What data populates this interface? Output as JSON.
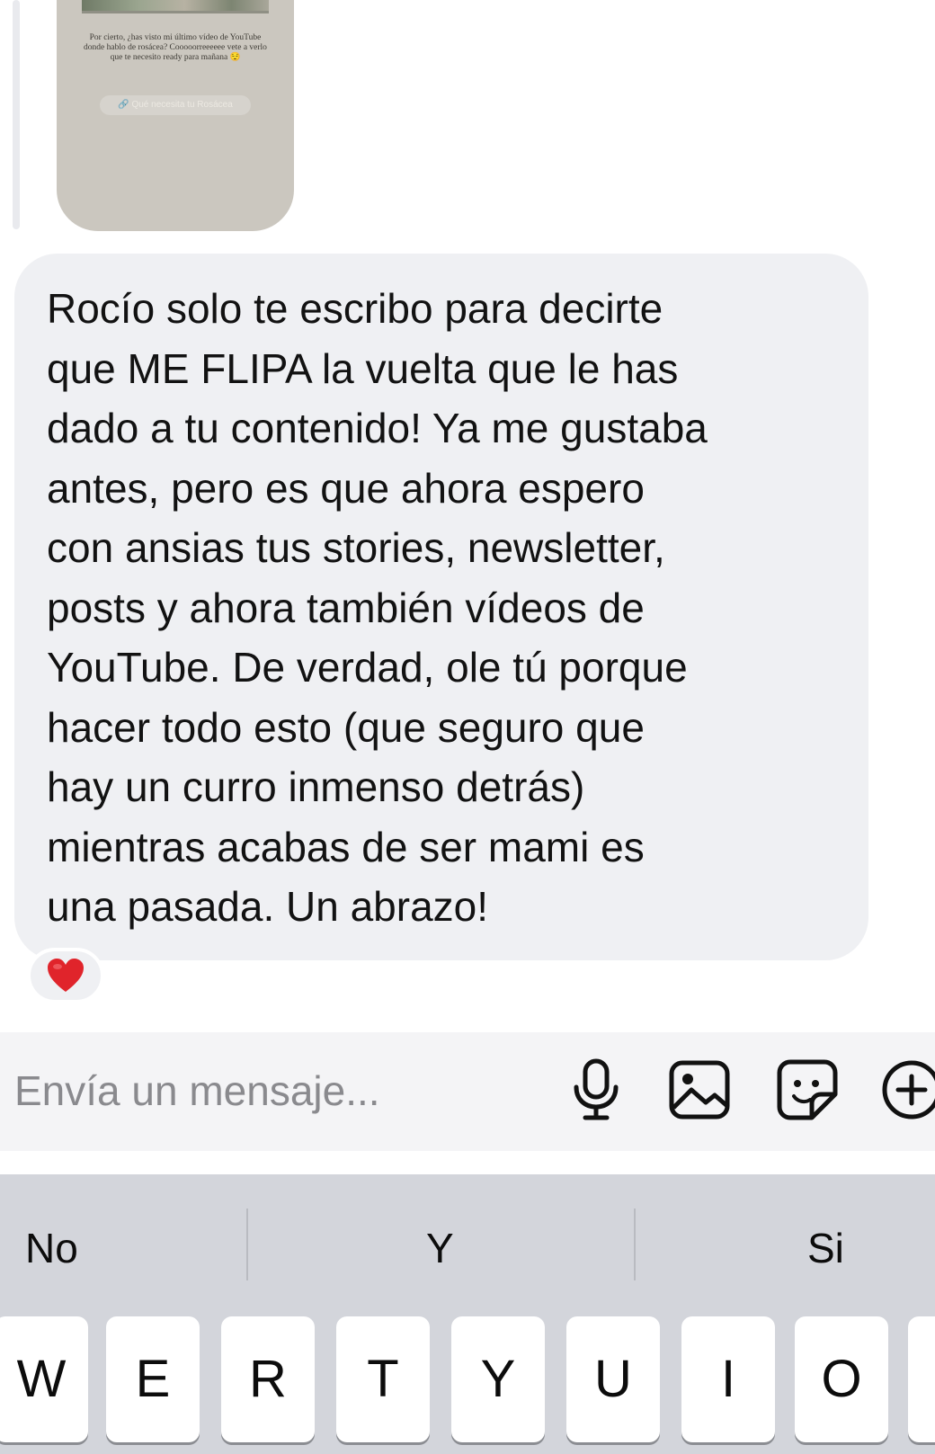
{
  "story": {
    "text": "Por cierto, ¿has visto mi último vídeo de YouTube donde hablo de rosácea? Cooooorreeeeee vete a verlo que te necesito ready para mañana 😌",
    "link_label": "🔗 Qué necesita tu Rosácea"
  },
  "message": {
    "text": "Rocío solo te escribo para decirte\nque ME FLIPA la vuelta que le has\ndado a tu contenido! Ya me gustaba\nantes, pero es que ahora espero\ncon ansias tus stories, newsletter,\nposts y ahora también vídeos de\nYouTube. De verdad, ole tú porque\nhacer todo esto (que seguro que\nhay un curro inmenso detrás)\nmientras acabas de ser mami es\nuna pasada. Un abrazo!",
    "reaction": "heart-emoji"
  },
  "composer": {
    "placeholder": "Envía un mensaje...",
    "icons": [
      "microphone-icon",
      "image-icon",
      "sticker-icon",
      "plus-circle-icon"
    ]
  },
  "keyboard": {
    "suggestions": [
      "No",
      "Y",
      "Si"
    ],
    "keys": [
      "W",
      "E",
      "R",
      "T",
      "Y",
      "U",
      "I",
      "O"
    ]
  },
  "colors": {
    "bubble": "#eff0f3",
    "keyboard_bg": "#d3d5db",
    "heart": "#e0242b"
  }
}
